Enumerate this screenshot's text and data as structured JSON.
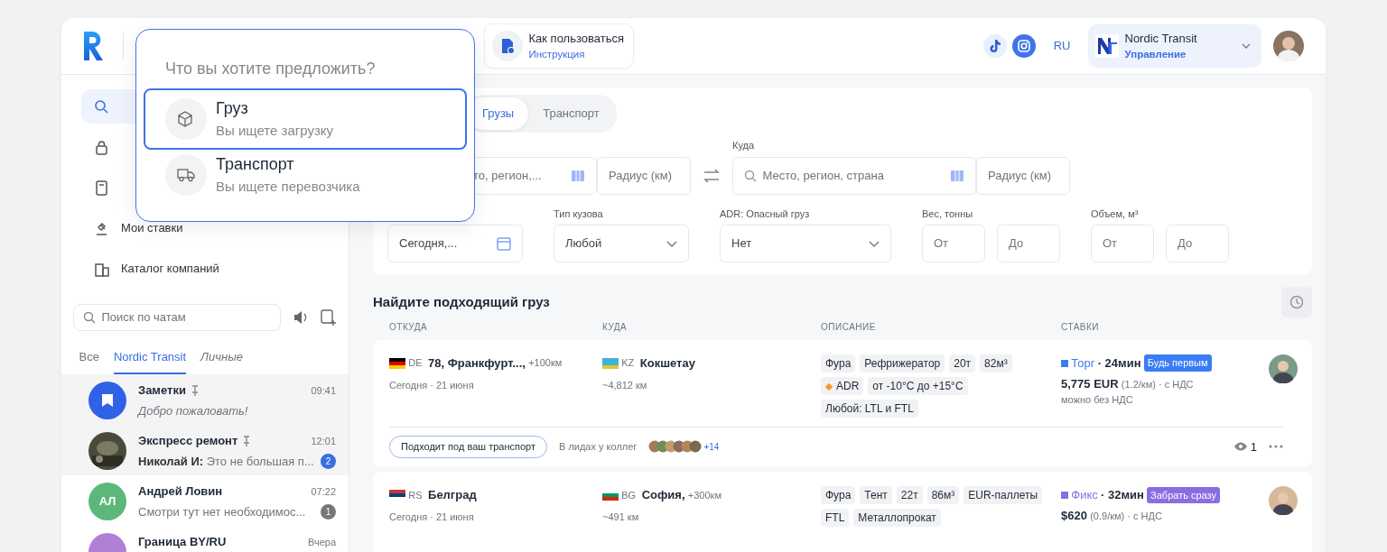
{
  "header": {
    "help": {
      "title": "Как пользоваться",
      "link": "Инструкция"
    },
    "language": "RU",
    "org": {
      "name": "Nordic Transit",
      "role": "Управление"
    }
  },
  "popup": {
    "title": "Что вы хотите предложить?",
    "options": [
      {
        "kind": "cargo",
        "title": "Груз",
        "subtitle": "Вы ищете загрузку",
        "selected": true
      },
      {
        "kind": "transport",
        "title": "Транспорт",
        "subtitle": "Вы ищете перевозчика",
        "selected": false
      }
    ]
  },
  "sidebar": {
    "nav": [
      {
        "kind": "search",
        "selected": true
      },
      {
        "kind": "lock",
        "selected": false
      },
      {
        "kind": "doc",
        "selected": false
      },
      {
        "kind": "bids",
        "label": "Мои ставки",
        "selected": false
      },
      {
        "kind": "catalog",
        "label": "Каталог компаний",
        "selected": false
      }
    ],
    "chat_search": {
      "placeholder": "Поиск по чатам"
    },
    "chat_tabs": [
      {
        "label": "Все",
        "selected": false
      },
      {
        "label": "Nordic Transit",
        "selected": true
      },
      {
        "label": "Личные",
        "selected": false
      }
    ],
    "chats": [
      {
        "kind": "bookmark",
        "color": "#2f62e6",
        "name": "Заметки",
        "pinned": true,
        "time": "09:41",
        "message": "Добро пожаловать!"
      },
      {
        "kind": "picture",
        "name": "Экспресс ремонт",
        "pinned": true,
        "time": "12:01",
        "sender": "Николай И:",
        "message": "Это не большая п...",
        "unread": "2",
        "unread_muted": false
      },
      {
        "kind": "initials",
        "initials": "АЛ",
        "color": "#5cb87a",
        "name": "Андрей Ловин",
        "pinned": false,
        "time": "07:22",
        "message": "Смотри тут нет необходимос...",
        "unread": "1",
        "unread_muted": true
      },
      {
        "kind": "initials",
        "color": "#b27fd6",
        "name": "Граница BY/RU",
        "pinned": false,
        "time": "Вчера"
      }
    ]
  },
  "search": {
    "tabs": [
      {
        "label": "Грузы",
        "selected": true
      },
      {
        "label": "Транспорт",
        "selected": false
      }
    ],
    "from": {
      "placeholder": "то, регион,...",
      "radius": {
        "placeholder": "Радиус (км)"
      }
    },
    "to": {
      "label": "Куда",
      "placeholder": "Место, регион, страна",
      "radius": {
        "placeholder": "Радиус (км)"
      }
    },
    "filters": [
      {
        "kind": "date",
        "value": "Сегодня,..."
      },
      {
        "kind": "select",
        "label": "Тип кузова",
        "value": "Любой"
      },
      {
        "kind": "select",
        "label": "ADR: Опасный груз",
        "value": "Нет"
      },
      {
        "kind": "range",
        "label": "Вес, тонны",
        "from": {
          "placeholder": "От"
        },
        "to": {
          "placeholder": "До"
        }
      },
      {
        "kind": "range",
        "label": "Объем, м³",
        "from": {
          "placeholder": "От"
        },
        "to": {
          "placeholder": "До"
        }
      }
    ]
  },
  "results": {
    "title": "Найдите подходящий груз",
    "columns": [
      "ОТКУДА",
      "КУДА",
      "ОПИСАНИЕ",
      "СТАВКИ"
    ],
    "rows": [
      {
        "from": {
          "country": "DE",
          "city": "78, Франкфурт...,",
          "extra": "+100км",
          "date": "Сегодня · 21 июня"
        },
        "to": {
          "country": "KZ",
          "city": "Кокшетау",
          "distance": "~4,812 км"
        },
        "tags": [
          {
            "text": "Фура"
          },
          {
            "text": "Рефрижератор"
          },
          {
            "text": "20т"
          },
          {
            "text": "82м³"
          },
          {
            "text": "ADR",
            "kind": "hazard"
          },
          {
            "text": "от -10°C до +15°C"
          },
          {
            "text": "Любой: LTL и FTL"
          }
        ],
        "rate": {
          "type": "Торг",
          "color": "#3b7cf5",
          "age": "· 24мин",
          "badge": "Будь первым",
          "price": "5,775 EUR",
          "detail": "(1.2/км) · с НДС",
          "note": "можно без НДС"
        },
        "footer": {
          "chip": "Подходит под ваш транспорт",
          "leads": "В лидах у коллег",
          "more": "+14",
          "views": "1"
        }
      },
      {
        "from": {
          "country": "RS",
          "city": "Белград",
          "date": "Сегодня · 21 июня"
        },
        "to": {
          "country": "BG",
          "city": "София,",
          "extra": "+300км",
          "distance": "~491 км"
        },
        "tags": [
          {
            "text": "Фура"
          },
          {
            "text": "Тент"
          },
          {
            "text": "22т"
          },
          {
            "text": "86м³"
          },
          {
            "text": "EUR-паллеты"
          },
          {
            "text": "FTL"
          },
          {
            "text": "Металлопрокат"
          }
        ],
        "rate": {
          "type": "Фикс",
          "color": "#8a6ee0",
          "age": "· 32мин",
          "badge": "Забрать сразу",
          "price": "$620",
          "detail": "(0.9/км) · с НДС"
        }
      }
    ]
  }
}
